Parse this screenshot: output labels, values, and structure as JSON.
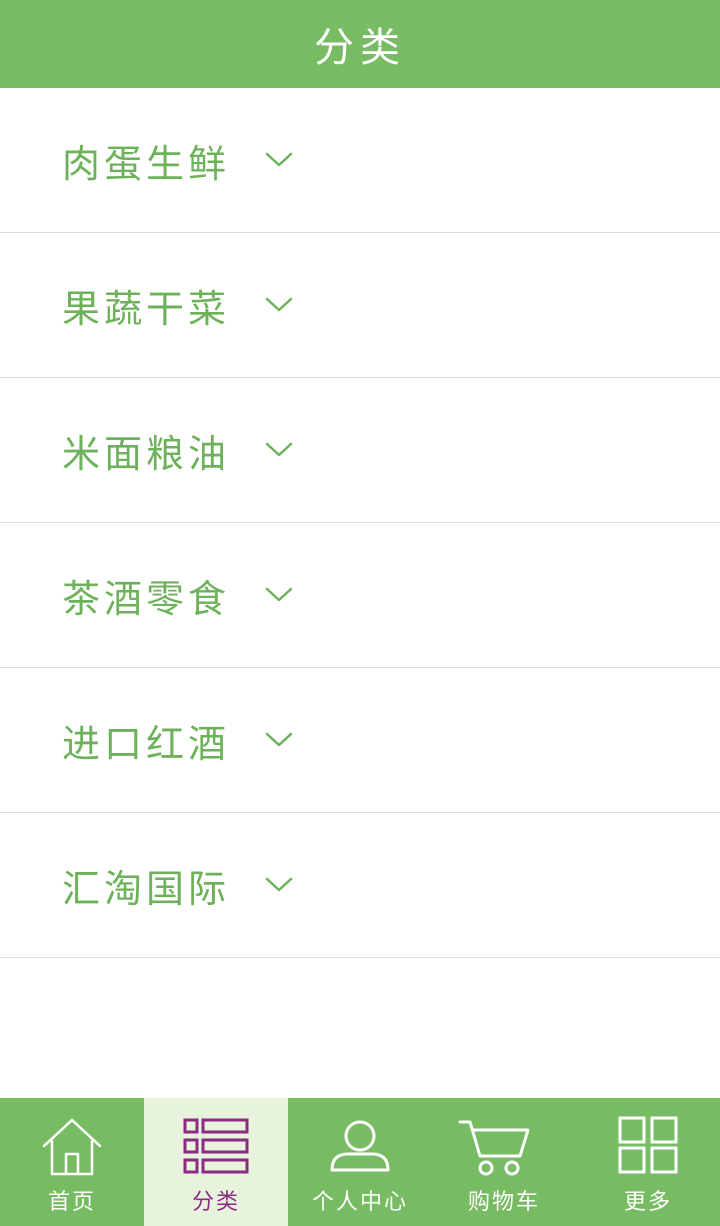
{
  "header": {
    "title": "分类"
  },
  "categories": [
    {
      "label": "肉蛋生鲜"
    },
    {
      "label": "果蔬干菜"
    },
    {
      "label": "米面粮油"
    },
    {
      "label": "茶酒零食"
    },
    {
      "label": "进口红酒"
    },
    {
      "label": "汇淘国际"
    }
  ],
  "tabbar": {
    "items": [
      {
        "label": "首页",
        "icon": "home-icon",
        "active": false
      },
      {
        "label": "分类",
        "icon": "category-list-icon",
        "active": true
      },
      {
        "label": "个人中心",
        "icon": "user-icon",
        "active": false
      },
      {
        "label": "购物车",
        "icon": "cart-icon",
        "active": false
      },
      {
        "label": "更多",
        "icon": "grid-icon",
        "active": false
      }
    ]
  },
  "colors": {
    "brand_green": "#77bb62",
    "label_green": "#6db25a",
    "active_tab_bg": "#e7f3dd",
    "active_tab_fg": "#8e2a84",
    "divider": "#dcdcdc"
  }
}
